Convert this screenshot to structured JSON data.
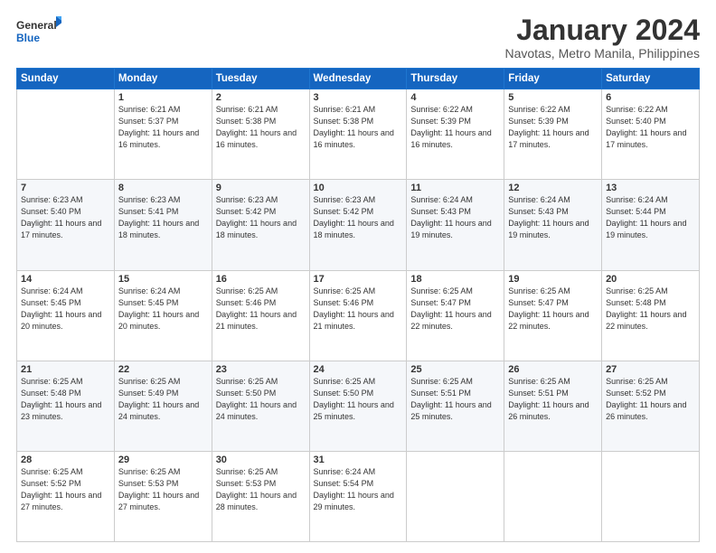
{
  "logo": {
    "line1": "General",
    "line2": "Blue"
  },
  "title": "January 2024",
  "subtitle": "Navotas, Metro Manila, Philippines",
  "weekdays": [
    "Sunday",
    "Monday",
    "Tuesday",
    "Wednesday",
    "Thursday",
    "Friday",
    "Saturday"
  ],
  "weeks": [
    [
      {
        "day": "",
        "sunrise": "",
        "sunset": "",
        "daylight": ""
      },
      {
        "day": "1",
        "sunrise": "Sunrise: 6:21 AM",
        "sunset": "Sunset: 5:37 PM",
        "daylight": "Daylight: 11 hours and 16 minutes."
      },
      {
        "day": "2",
        "sunrise": "Sunrise: 6:21 AM",
        "sunset": "Sunset: 5:38 PM",
        "daylight": "Daylight: 11 hours and 16 minutes."
      },
      {
        "day": "3",
        "sunrise": "Sunrise: 6:21 AM",
        "sunset": "Sunset: 5:38 PM",
        "daylight": "Daylight: 11 hours and 16 minutes."
      },
      {
        "day": "4",
        "sunrise": "Sunrise: 6:22 AM",
        "sunset": "Sunset: 5:39 PM",
        "daylight": "Daylight: 11 hours and 16 minutes."
      },
      {
        "day": "5",
        "sunrise": "Sunrise: 6:22 AM",
        "sunset": "Sunset: 5:39 PM",
        "daylight": "Daylight: 11 hours and 17 minutes."
      },
      {
        "day": "6",
        "sunrise": "Sunrise: 6:22 AM",
        "sunset": "Sunset: 5:40 PM",
        "daylight": "Daylight: 11 hours and 17 minutes."
      }
    ],
    [
      {
        "day": "7",
        "sunrise": "Sunrise: 6:23 AM",
        "sunset": "Sunset: 5:40 PM",
        "daylight": "Daylight: 11 hours and 17 minutes."
      },
      {
        "day": "8",
        "sunrise": "Sunrise: 6:23 AM",
        "sunset": "Sunset: 5:41 PM",
        "daylight": "Daylight: 11 hours and 18 minutes."
      },
      {
        "day": "9",
        "sunrise": "Sunrise: 6:23 AM",
        "sunset": "Sunset: 5:42 PM",
        "daylight": "Daylight: 11 hours and 18 minutes."
      },
      {
        "day": "10",
        "sunrise": "Sunrise: 6:23 AM",
        "sunset": "Sunset: 5:42 PM",
        "daylight": "Daylight: 11 hours and 18 minutes."
      },
      {
        "day": "11",
        "sunrise": "Sunrise: 6:24 AM",
        "sunset": "Sunset: 5:43 PM",
        "daylight": "Daylight: 11 hours and 19 minutes."
      },
      {
        "day": "12",
        "sunrise": "Sunrise: 6:24 AM",
        "sunset": "Sunset: 5:43 PM",
        "daylight": "Daylight: 11 hours and 19 minutes."
      },
      {
        "day": "13",
        "sunrise": "Sunrise: 6:24 AM",
        "sunset": "Sunset: 5:44 PM",
        "daylight": "Daylight: 11 hours and 19 minutes."
      }
    ],
    [
      {
        "day": "14",
        "sunrise": "Sunrise: 6:24 AM",
        "sunset": "Sunset: 5:45 PM",
        "daylight": "Daylight: 11 hours and 20 minutes."
      },
      {
        "day": "15",
        "sunrise": "Sunrise: 6:24 AM",
        "sunset": "Sunset: 5:45 PM",
        "daylight": "Daylight: 11 hours and 20 minutes."
      },
      {
        "day": "16",
        "sunrise": "Sunrise: 6:25 AM",
        "sunset": "Sunset: 5:46 PM",
        "daylight": "Daylight: 11 hours and 21 minutes."
      },
      {
        "day": "17",
        "sunrise": "Sunrise: 6:25 AM",
        "sunset": "Sunset: 5:46 PM",
        "daylight": "Daylight: 11 hours and 21 minutes."
      },
      {
        "day": "18",
        "sunrise": "Sunrise: 6:25 AM",
        "sunset": "Sunset: 5:47 PM",
        "daylight": "Daylight: 11 hours and 22 minutes."
      },
      {
        "day": "19",
        "sunrise": "Sunrise: 6:25 AM",
        "sunset": "Sunset: 5:47 PM",
        "daylight": "Daylight: 11 hours and 22 minutes."
      },
      {
        "day": "20",
        "sunrise": "Sunrise: 6:25 AM",
        "sunset": "Sunset: 5:48 PM",
        "daylight": "Daylight: 11 hours and 22 minutes."
      }
    ],
    [
      {
        "day": "21",
        "sunrise": "Sunrise: 6:25 AM",
        "sunset": "Sunset: 5:48 PM",
        "daylight": "Daylight: 11 hours and 23 minutes."
      },
      {
        "day": "22",
        "sunrise": "Sunrise: 6:25 AM",
        "sunset": "Sunset: 5:49 PM",
        "daylight": "Daylight: 11 hours and 24 minutes."
      },
      {
        "day": "23",
        "sunrise": "Sunrise: 6:25 AM",
        "sunset": "Sunset: 5:50 PM",
        "daylight": "Daylight: 11 hours and 24 minutes."
      },
      {
        "day": "24",
        "sunrise": "Sunrise: 6:25 AM",
        "sunset": "Sunset: 5:50 PM",
        "daylight": "Daylight: 11 hours and 25 minutes."
      },
      {
        "day": "25",
        "sunrise": "Sunrise: 6:25 AM",
        "sunset": "Sunset: 5:51 PM",
        "daylight": "Daylight: 11 hours and 25 minutes."
      },
      {
        "day": "26",
        "sunrise": "Sunrise: 6:25 AM",
        "sunset": "Sunset: 5:51 PM",
        "daylight": "Daylight: 11 hours and 26 minutes."
      },
      {
        "day": "27",
        "sunrise": "Sunrise: 6:25 AM",
        "sunset": "Sunset: 5:52 PM",
        "daylight": "Daylight: 11 hours and 26 minutes."
      }
    ],
    [
      {
        "day": "28",
        "sunrise": "Sunrise: 6:25 AM",
        "sunset": "Sunset: 5:52 PM",
        "daylight": "Daylight: 11 hours and 27 minutes."
      },
      {
        "day": "29",
        "sunrise": "Sunrise: 6:25 AM",
        "sunset": "Sunset: 5:53 PM",
        "daylight": "Daylight: 11 hours and 27 minutes."
      },
      {
        "day": "30",
        "sunrise": "Sunrise: 6:25 AM",
        "sunset": "Sunset: 5:53 PM",
        "daylight": "Daylight: 11 hours and 28 minutes."
      },
      {
        "day": "31",
        "sunrise": "Sunrise: 6:24 AM",
        "sunset": "Sunset: 5:54 PM",
        "daylight": "Daylight: 11 hours and 29 minutes."
      },
      {
        "day": "",
        "sunrise": "",
        "sunset": "",
        "daylight": ""
      },
      {
        "day": "",
        "sunrise": "",
        "sunset": "",
        "daylight": ""
      },
      {
        "day": "",
        "sunrise": "",
        "sunset": "",
        "daylight": ""
      }
    ]
  ]
}
